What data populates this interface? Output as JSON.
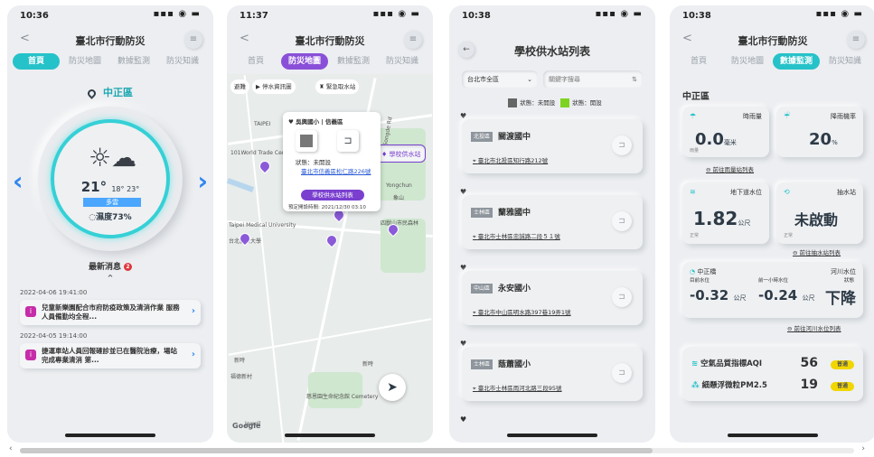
{
  "phone1": {
    "status_time": "10:36",
    "title": "臺北市行動防災",
    "tabs": [
      "首頁",
      "防災地圖",
      "數據監測",
      "防災知識"
    ],
    "district": "中正區",
    "weather": {
      "temp": "21°",
      "low": "18°",
      "high": "23°",
      "low_label": "低溫",
      "high_label": "高溫",
      "condition": "多雲",
      "humidity_label": "濕度",
      "humidity": "73%"
    },
    "news_title": "最新消息",
    "news_count": "2",
    "news": [
      {
        "date": "2022-04-06 19:41:00",
        "text": "兒童新樂園配合市府防疫政策及清消作業 服務人員備勤均全程..."
      },
      {
        "date": "2022-04-05 19:14:00",
        "text": "捷運車站人員回報確診並已在醫院治療，場站完成專業清消 第..."
      }
    ]
  },
  "phone2": {
    "status_time": "11:37",
    "title": "臺北市行動防災",
    "tabs": [
      "首頁",
      "防災地圖",
      "數據監測",
      "防災知識"
    ],
    "filters": [
      "避難",
      "停水資訊圖",
      "緊急取水站",
      "學校供水站"
    ],
    "popup": {
      "title": "吳興國小 | 信義區",
      "status_label": "狀態：",
      "status": "未開設",
      "address": "臺北市信義區松仁路226號",
      "button": "學校供水站列表",
      "updated": "預定開設時間: 2021/12/30 03:10"
    },
    "map_labels": [
      "TAIPEI",
      "101World Trade Center",
      "Yongchun",
      "象山",
      "Songde Rd",
      "四獸山市民森林",
      "Taipei Medical University",
      "台北醫學大學",
      "新時",
      "新時",
      "慈恩園生命紀念館 Cemetery",
      "Google",
      "福德新村",
      "Jewell"
    ]
  },
  "phone3": {
    "status_time": "10:38",
    "title": "學校供水站列表",
    "district_select": "台北市全區",
    "search_placeholder": "關鍵字搜尋",
    "legend_closed": "狀態：未開設",
    "legend_open": "狀態：開設",
    "schools": [
      {
        "district": "北投區",
        "name": "關渡國中",
        "address": "臺北市北投區知行路212號"
      },
      {
        "district": "士林區",
        "name": "蘭雅國中",
        "address": "臺北市士林區忠誠路二段５１號"
      },
      {
        "district": "中山區",
        "name": "永安國小",
        "address": "臺北市中山區明水路397巷19弄1號"
      },
      {
        "district": "士林區",
        "name": "蔭蕭國小",
        "address": "臺北市士林區雨河北路三段95號"
      }
    ]
  },
  "phone4": {
    "status_time": "10:38",
    "title": "臺北市行動防災",
    "tabs": [
      "首頁",
      "防災地圖",
      "數據監測",
      "防災知識"
    ],
    "district": "中正區",
    "rain": {
      "label": "時雨量",
      "value": "0.0",
      "unit": "毫米",
      "sub": "雨量"
    },
    "prob": {
      "label": "降雨機率",
      "value": "20",
      "unit": "%"
    },
    "rain_link": "前往雨量站列表",
    "underpass": {
      "label": "地下道水位",
      "value": "1.82",
      "unit": "公尺",
      "sub": "正常"
    },
    "pump": {
      "label": "抽水站",
      "value": "未啟動",
      "sub": "正常"
    },
    "pump_link": "前往抽水站列表",
    "river": {
      "station": "中正橋",
      "title": "河川水位",
      "cur_label": "目前水位",
      "cur": "-0.32",
      "prev_label": "前一小時水位",
      "prev": "-0.24",
      "unit": "公尺",
      "state_label": "狀態",
      "state": "下降"
    },
    "river_link": "前往河川水位列表",
    "aqi": {
      "label": "空氣品質指標AQI",
      "value": "56",
      "badge": "普通"
    },
    "pm25": {
      "label": "細懸浮微粒PM2.5",
      "value": "19",
      "badge": "普通"
    }
  },
  "colors": {
    "accent": "#26c2c9",
    "link": "#2f86f0",
    "purple": "#7a3fcf",
    "badge": "#f2d600"
  }
}
